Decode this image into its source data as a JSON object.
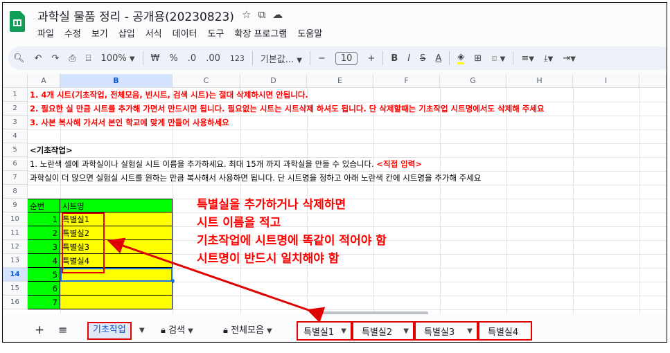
{
  "title": "과학실 물품 정리 - 공개용(20230823)",
  "title_icons": [
    "star-icon",
    "folder-move-icon",
    "cloud-status-icon"
  ],
  "menu": [
    "파일",
    "수정",
    "보기",
    "삽입",
    "서식",
    "데이터",
    "도구",
    "확장 프로그램",
    "도움말"
  ],
  "toolbar": {
    "zoom": "100%",
    "currency": "₩",
    "percent": "%",
    "dec_down": ".0",
    "dec_up": ".00",
    "number_format": "123",
    "font_name": "기본값...",
    "font_size": "10",
    "minus": "−",
    "plus": "+",
    "bold": "B",
    "italic": "I",
    "strike": "S",
    "text_color": "A"
  },
  "columns": [
    "A",
    "B",
    "C",
    "D",
    "E",
    "F",
    "G",
    "H",
    "I"
  ],
  "selected_column": "B",
  "rows": [
    "1",
    "1",
    "2",
    "3",
    "4",
    "5",
    "6",
    "7",
    "8",
    "9",
    "10",
    "11",
    "12",
    "13",
    "14",
    "15",
    "16"
  ],
  "selected_row": "14",
  "cells": {
    "r1": "1. 4개 시트(기초작업, 전체모음, 빈시트, 검색 시트)는 절대 삭제하시면 안됩니다.",
    "r2": "2. 필요한 실 만큼 시트를 추가해 가면서 만드시면 됩니다. 필요없는 시트는 시트삭제 하셔도 됩니다. 단 삭제할때는 기초작업 시트명에서도 삭제해 주세요",
    "r3": "3. 사본 복사해 가셔서 본인 학교에 맞게 만들어 사용하세요",
    "r5": "<기초작업>",
    "r6a": "1. 노란색 셀에 과학실이나 실험실 시트 이름을 추가하세요. 최대 15개 까지 과학실을 만들 수 있습니다.",
    "r6b": "<직접 입력>",
    "r7": "과학실이 더 많으면 실험실 시트를 원하는 만큼 복사해서 사용하면 됩니다. 단 시트명을 정하고 아래 노란색 칸에 시트명을 추가해 주세요",
    "header_num": "순번",
    "header_name": "시트명"
  },
  "table": [
    {
      "num": "1",
      "name": "특별실1"
    },
    {
      "num": "2",
      "name": "특별실2"
    },
    {
      "num": "3",
      "name": "특별실3"
    },
    {
      "num": "4",
      "name": "특별실4"
    },
    {
      "num": "5",
      "name": ""
    },
    {
      "num": "6",
      "name": ""
    },
    {
      "num": "7",
      "name": ""
    }
  ],
  "annotation": [
    "특별실을 추가하거나 삭제하면",
    "시트 이름을 적고",
    "기초작업에 시트명에 똑같이 적어야 함",
    "시트명이 반드시 일치해야 함"
  ],
  "tabs": {
    "add": "+",
    "all_sheets": "≡",
    "active": "기초작업",
    "search": "검색",
    "collection": "전체모음",
    "special": [
      "특별실1",
      "특별실2",
      "특별실3",
      "특별실4"
    ]
  },
  "colors": {
    "accent": "#0b57d0",
    "annotation": "#ff0000",
    "yellow": "#ffff00",
    "green": "#00ff00"
  }
}
